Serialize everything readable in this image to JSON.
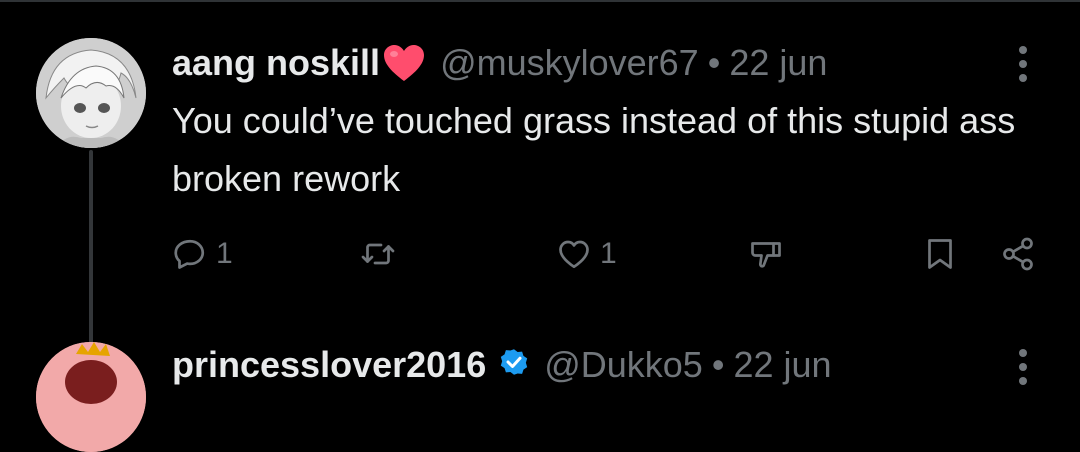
{
  "reply": {
    "display_name": "aang noskill",
    "handle": "@muskylover67",
    "separator": "•",
    "date": "22 jun",
    "text": "You could’ve touched grass instead of this stupid ass broken rework",
    "actions": {
      "reply_count": "1",
      "repost_count": "",
      "like_count": "1"
    }
  },
  "next_reply": {
    "display_name": "princesslover2016",
    "handle": "@Dukko5",
    "separator": "•",
    "date": "22 jun"
  },
  "colors": {
    "background": "#000000",
    "text": "#e7e9ea",
    "muted": "#71767b",
    "heart": "#ff4d6d",
    "verified": "#1d9bf0",
    "thread_line": "#333639"
  },
  "icons": [
    "heart-emoji-icon",
    "more-options-icon",
    "reply-icon",
    "repost-icon",
    "like-icon",
    "dislike-icon",
    "bookmark-icon",
    "share-icon",
    "verified-badge-icon"
  ]
}
